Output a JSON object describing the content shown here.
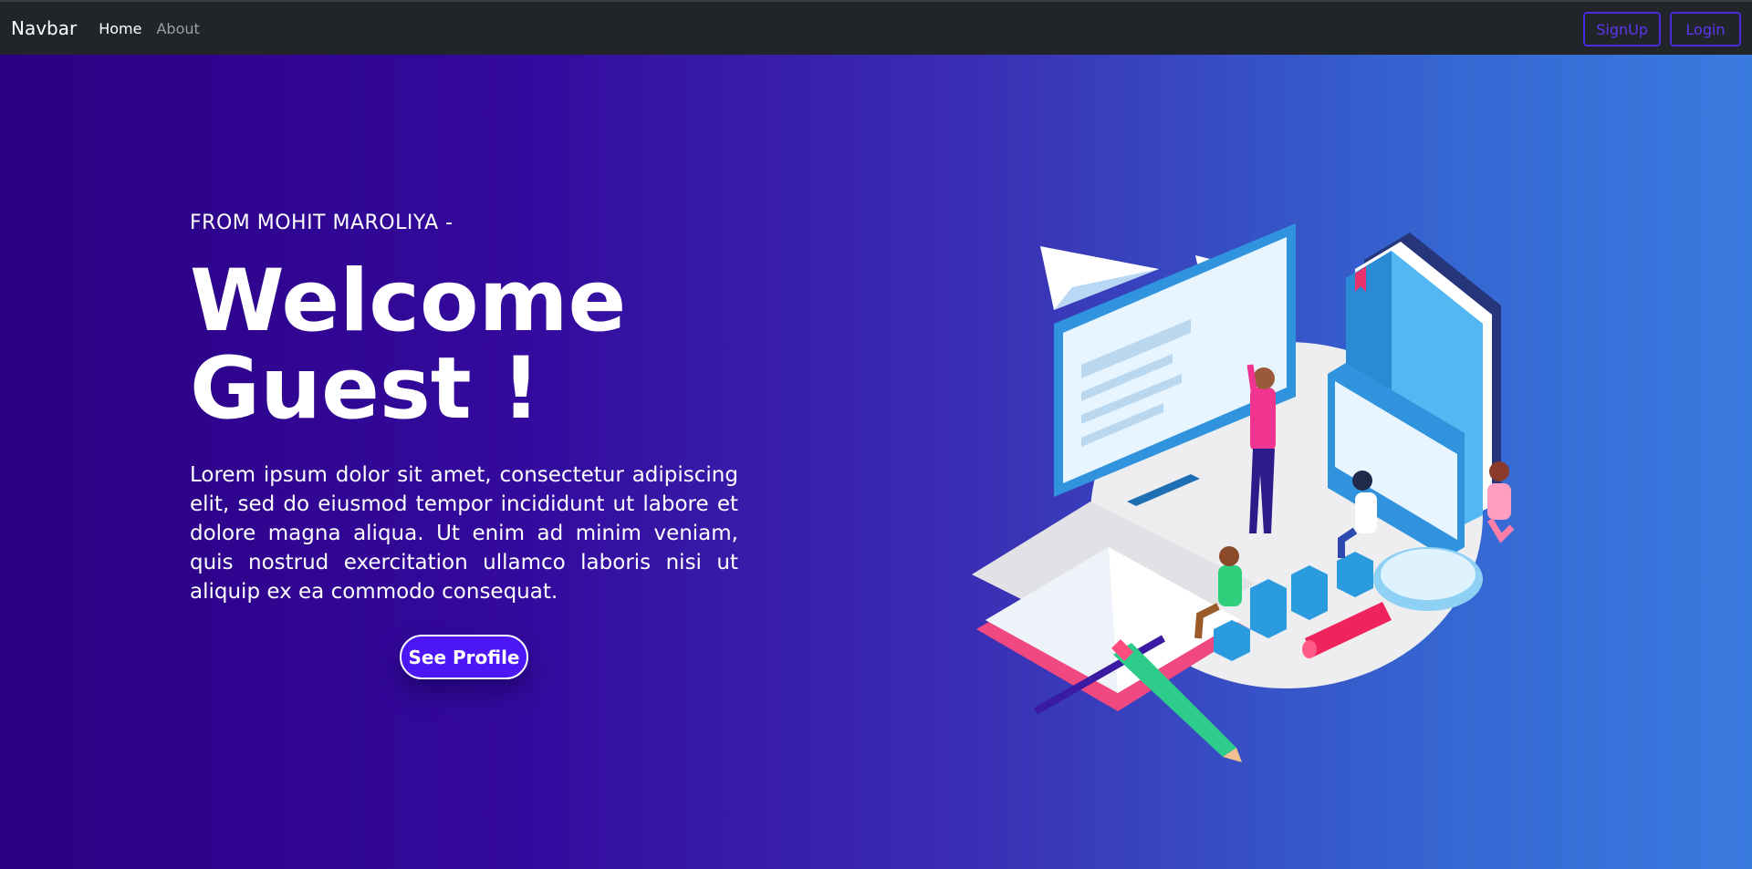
{
  "navbar": {
    "brand": "Navbar",
    "links": [
      {
        "label": "Home",
        "active": true
      },
      {
        "label": "About",
        "active": false
      }
    ],
    "buttons": {
      "signup": "SignUp",
      "login": "Login"
    }
  },
  "hero": {
    "eyebrow": "FROM MOHIT MAROLIYA -",
    "title_line1": "Welcome",
    "title_line2": "Guest !",
    "description": "Lorem ipsum dolor sit amet, consectetur adipiscing elit, sed do eiusmod tempor incididunt ut labore et dolore magna aliqua. Ut enim ad minim veniam, quis nostrud exercitation ullamco laboris nisi ut aliquip ex ea commodo consequat.",
    "cta_label": "See Profile"
  },
  "colors": {
    "navbar_bg": "#212529",
    "accent": "#4d17f5",
    "outline_button": "#4b2bd8",
    "hero_gradient_start": "#2b0082",
    "hero_gradient_end": "#3a7be0"
  },
  "illustration": {
    "icon": "isometric-learning-illustration"
  }
}
